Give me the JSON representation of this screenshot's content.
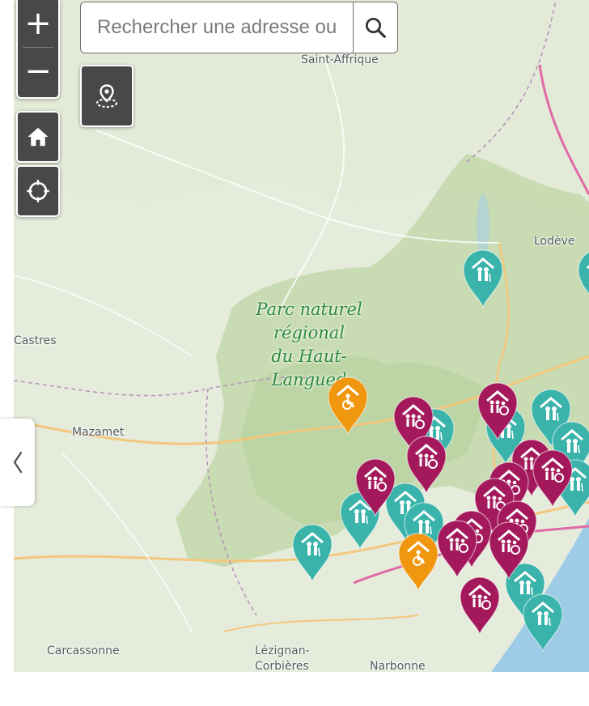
{
  "search": {
    "placeholder": "Rechercher une adresse ou"
  },
  "controls": {
    "zoom_in_label": "+",
    "zoom_out_label": "−",
    "collapse_glyph": "‹"
  },
  "map": {
    "places": [
      {
        "id": "saint-affrique",
        "label": "Saint-Affrique"
      },
      {
        "id": "lodeve",
        "label": "Lodève"
      },
      {
        "id": "castres",
        "label": "Castres"
      },
      {
        "id": "mazamet",
        "label": "Mazamet"
      },
      {
        "id": "carcassonne",
        "label": "Carcassonne"
      },
      {
        "id": "lezignan",
        "label": "Lézignan-"
      },
      {
        "id": "corbieres",
        "label": "Corbières"
      },
      {
        "id": "narbonne",
        "label": "Narbonne"
      }
    ],
    "park_label_lines": [
      "Parc naturel",
      "régional",
      "du Haut-",
      "Langued"
    ]
  },
  "marker_types": {
    "teal": {
      "color": "#3ab3aa",
      "icon": "elderly-home-icon"
    },
    "magenta": {
      "color": "#a3195b",
      "icon": "disability-group-icon"
    },
    "orange": {
      "color": "#f0960f",
      "icon": "wheelchair-home-icon"
    }
  },
  "icons": {
    "search": "search-icon",
    "geolocate": "geolocate-pin-icon",
    "home": "home-icon",
    "locate": "target-icon",
    "collapse": "chevron-left-icon"
  }
}
